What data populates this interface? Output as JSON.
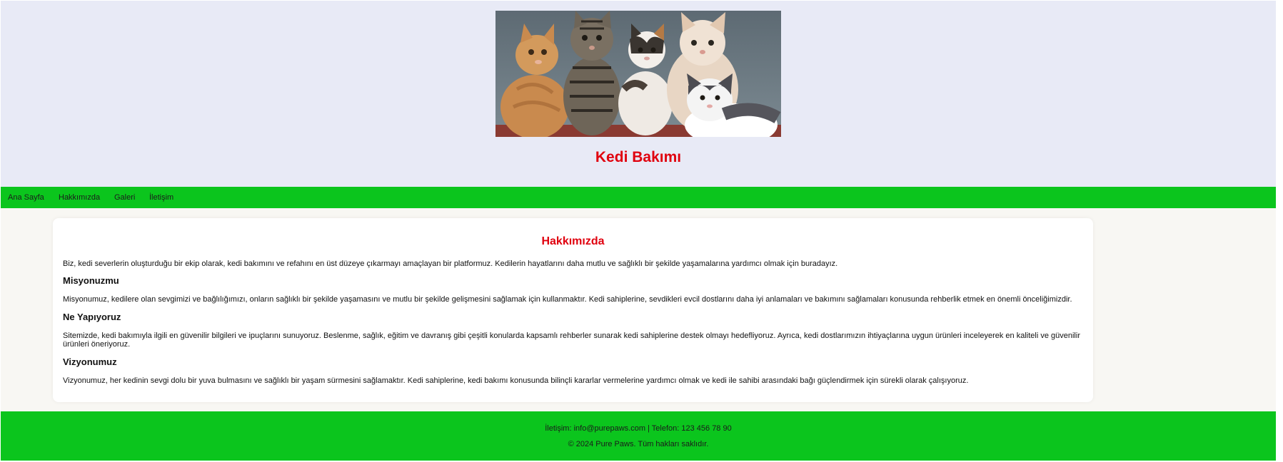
{
  "header": {
    "hero_image": "kittens-photo",
    "title": "Kedi Bakımı"
  },
  "nav": {
    "items": [
      {
        "label": "Ana Sayfa"
      },
      {
        "label": "Hakkımızda"
      },
      {
        "label": "Galeri"
      },
      {
        "label": "İletişim"
      }
    ]
  },
  "main": {
    "heading": "Hakkımızda",
    "intro": "Biz, kedi severlerin oluşturduğu bir ekip olarak, kedi bakımını ve refahını en üst düzeye çıkarmayı amaçlayan bir platformuz. Kedilerin hayatlarını daha mutlu ve sağlıklı bir şekilde yaşamalarına yardımcı olmak için buradayız.",
    "sections": [
      {
        "title": "Misyonuzmu",
        "text": "Misyonumuz, kedilere olan sevgimizi ve bağlılığımızı, onların sağlıklı bir şekilde yaşamasını ve mutlu bir şekilde gelişmesini sağlamak için kullanmaktır. Kedi sahiplerine, sevdikleri evcil dostlarını daha iyi anlamaları ve bakımını sağlamaları konusunda rehberlik etmek en önemli önceliğimizdir."
      },
      {
        "title": "Ne Yapıyoruz",
        "text": "Sitemizde, kedi bakımıyla ilgili en güvenilir bilgileri ve ipuçlarını sunuyoruz. Beslenme, sağlık, eğitim ve davranış gibi çeşitli konularda kapsamlı rehberler sunarak kedi sahiplerine destek olmayı hedefliyoruz. Ayrıca, kedi dostlarımızın ihtiyaçlarına uygun ürünleri inceleyerek en kaliteli ve güvenilir ürünleri öneriyoruz."
      },
      {
        "title": "Vizyonumuz",
        "text": "Vizyonumuz, her kedinin sevgi dolu bir yuva bulmasını ve sağlıklı bir yaşam sürmesini sağlamaktır. Kedi sahiplerine, kedi bakımı konusunda bilinçli kararlar vermelerine yardımcı olmak ve kedi ile sahibi arasındaki bağı güçlendirmek için sürekli olarak çalışıyoruz."
      }
    ]
  },
  "footer": {
    "contact": "İletişim: info@purepaws.com | Telefon: 123 456 78 90",
    "copyright": "© 2024 Pure Paws. Tüm hakları saklıdır."
  },
  "colors": {
    "header_bg": "#e8eaf6",
    "nav_bg": "#0bc51d",
    "accent_red": "#e0000e",
    "page_bg": "#f8f7f3",
    "card_bg": "#ffffff"
  }
}
